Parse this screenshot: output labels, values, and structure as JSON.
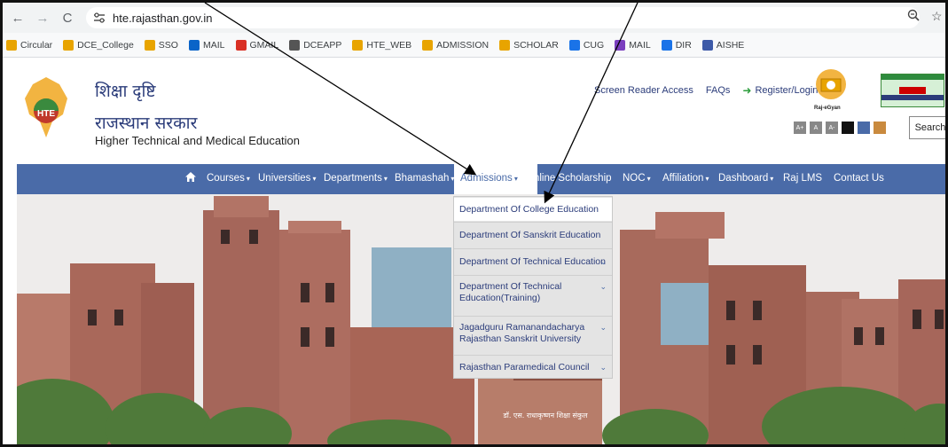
{
  "browser": {
    "url": "hte.rajasthan.gov.in",
    "bookmarks": [
      {
        "label": "Circular",
        "icon": "star-icon",
        "color": "#e8a400"
      },
      {
        "label": "DCE_College",
        "icon": "star-icon",
        "color": "#e8a400"
      },
      {
        "label": "SSO",
        "icon": "star-icon",
        "color": "#e8a400"
      },
      {
        "label": "MAIL",
        "icon": "outlook-icon",
        "color": "#0a64c8"
      },
      {
        "label": "GMAIL",
        "icon": "gmail-icon",
        "color": "#d93025"
      },
      {
        "label": "DCEAPP",
        "icon": "globe-icon",
        "color": "#555555"
      },
      {
        "label": "HTE_WEB",
        "icon": "star-icon",
        "color": "#e8a400"
      },
      {
        "label": "ADMISSION",
        "icon": "star-icon",
        "color": "#e8a400"
      },
      {
        "label": "SCHOLAR",
        "icon": "star-icon",
        "color": "#e8a400"
      },
      {
        "label": "CUG",
        "icon": "people-icon",
        "color": "#1a73e8"
      },
      {
        "label": "MAIL",
        "icon": "mail-icon",
        "color": "#7b3fbf"
      },
      {
        "label": "DIR",
        "icon": "people-icon",
        "color": "#1a73e8"
      },
      {
        "label": "AISHE",
        "icon": "aishe-icon",
        "color": "#3d5aa8"
      }
    ]
  },
  "header": {
    "title_hindi_1": "शिक्षा दृष्टि",
    "title_hindi_2": "राजस्थान सरकार",
    "title_english": "Higher Technical and Medical Education",
    "logo_text": "HTE",
    "links": {
      "screen_reader": "Screen Reader Access",
      "faqs": "FAQs",
      "register": "Register/Login"
    },
    "egyan_label": "Raj-eGyan",
    "search_label": "Search",
    "font_buttons": [
      "A+",
      "A",
      "A-"
    ],
    "theme_colors": [
      "#111111",
      "#4a6ba8",
      "#c98a3e"
    ]
  },
  "nav": {
    "items": [
      "Courses",
      "Universities",
      "Departments",
      "Bhamashah",
      "Admissions",
      "Online Scholarship",
      "NOC",
      "Affiliation",
      "Dashboard",
      "Raj LMS",
      "Contact Us"
    ],
    "active": "Admissions"
  },
  "dropdown": {
    "items": [
      "Department Of College Education",
      "Department Of Sanskrit Education",
      "Department Of Technical Education",
      "Department Of Technical Education(Training)",
      "Jagadguru Ramanandacharya Rajasthan Sanskrit University",
      "Rajasthan Paramedical Council"
    ]
  },
  "hero": {
    "building_sign": "डॉ. एस. राधाकृष्णन शिक्षा संकुल"
  },
  "colors": {
    "nav_blue": "#4a6ba8",
    "brand_text": "#2b3c7a"
  }
}
